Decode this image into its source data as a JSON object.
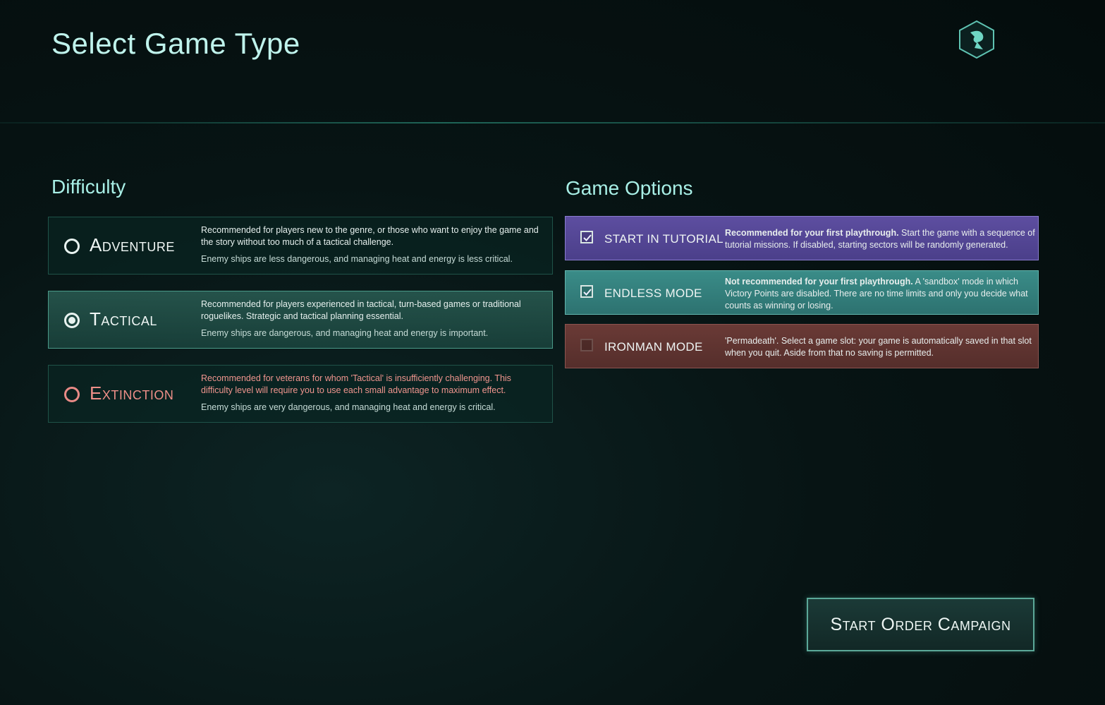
{
  "title": "Select Game Type",
  "difficulty": {
    "heading": "Difficulty",
    "options": [
      {
        "name": "Adventure",
        "description": "Recommended for players new to the genre, or those who want to enjoy the game and the story without too much of a tactical challenge.",
        "detail": "Enemy ships are less dangerous, and managing heat and energy is less critical.",
        "selected": false
      },
      {
        "name": "Tactical",
        "description": "Recommended for players experienced in tactical, turn-based games or traditional roguelikes. Strategic and tactical planning essential.",
        "detail": "Enemy ships are dangerous, and managing heat and energy is important.",
        "selected": true
      },
      {
        "name": "Extinction",
        "description": "Recommended for veterans for whom 'Tactical' is insufficiently challenging. This difficulty level will require you to use each small advantage to maximum effect.",
        "detail": "Enemy ships are very dangerous, and managing heat and energy is critical.",
        "selected": false
      }
    ]
  },
  "game_options": {
    "heading": "Game Options",
    "options": [
      {
        "name": "START IN TUTORIAL",
        "emphasis": "Recommended for your first playthrough.",
        "description": " Start the game with a sequence of tutorial missions. If disabled, starting sectors will be randomly generated.",
        "checked": true,
        "color": "#5d4ea0"
      },
      {
        "name": "ENDLESS MODE",
        "emphasis": "Not recommended for your first playthrough.",
        "description": " A 'sandbox' mode in which Victory Points are disabled.  There are no time limits and only you decide what counts as winning or losing.",
        "checked": true,
        "color": "#3a8c88"
      },
      {
        "name": "IRONMAN MODE",
        "emphasis": "",
        "description": "'Permadeath'. Select a game slot: your game is automatically saved in that slot when you quit. Aside from that no saving is permitted.",
        "checked": false,
        "color": "#6a3a36"
      }
    ]
  },
  "start_button": "Start Order Campaign",
  "icons": {
    "logo": "hexagon-logo-icon",
    "check": "checkmark-icon"
  }
}
